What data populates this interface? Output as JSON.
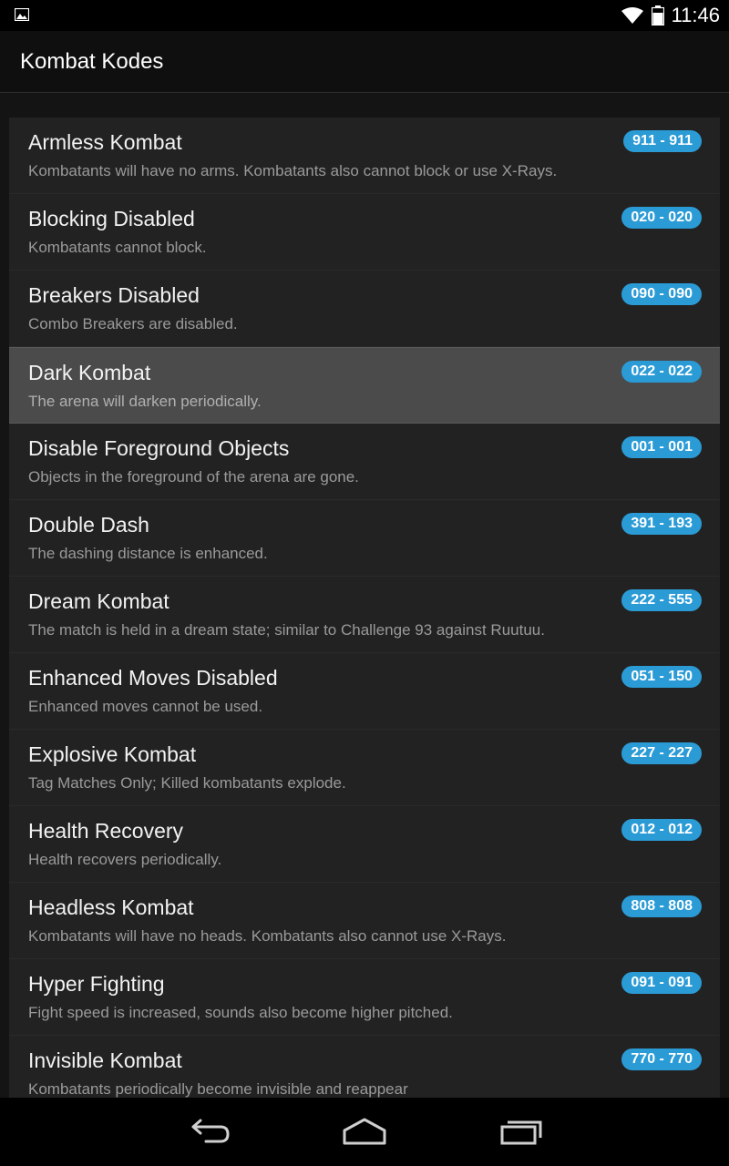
{
  "status_bar": {
    "time": "11:46",
    "icons": [
      "gallery-icon",
      "wifi-icon",
      "battery-icon"
    ]
  },
  "action_bar": {
    "title": "Kombat Kodes"
  },
  "kodes": [
    {
      "name": "Armless Kombat",
      "description": "Kombatants will have no arms. Kombatants also cannot block or use X-Rays.",
      "code": "911 - 911"
    },
    {
      "name": "Blocking Disabled",
      "description": "Kombatants cannot block.",
      "code": "020 - 020"
    },
    {
      "name": "Breakers Disabled",
      "description": "Combo Breakers are disabled.",
      "code": "090 - 090"
    },
    {
      "name": "Dark Kombat",
      "description": "The arena will darken periodically.",
      "code": "022 - 022",
      "selected": true
    },
    {
      "name": "Disable Foreground Objects",
      "description": "Objects in the foreground of the arena are gone.",
      "code": "001 - 001"
    },
    {
      "name": "Double Dash",
      "description": "The dashing distance is enhanced.",
      "code": "391 - 193"
    },
    {
      "name": "Dream Kombat",
      "description": "The match is held in a dream state; similar to Challenge 93 against Ruutuu.",
      "code": "222 - 555"
    },
    {
      "name": "Enhanced Moves Disabled",
      "description": "Enhanced moves cannot be used.",
      "code": "051 - 150"
    },
    {
      "name": "Explosive Kombat",
      "description": "Tag Matches Only; Killed kombatants explode.",
      "code": "227 - 227"
    },
    {
      "name": "Health Recovery",
      "description": "Health recovers periodically.",
      "code": "012 - 012"
    },
    {
      "name": "Headless Kombat",
      "description": "Kombatants will have no heads. Kombatants also cannot use X-Rays.",
      "code": "808 - 808"
    },
    {
      "name": "Hyper Fighting",
      "description": "Fight speed is increased, sounds also become higher pitched.",
      "code": "091 - 091"
    },
    {
      "name": "Invisible Kombat",
      "description": "Kombatants periodically become invisible and reappear",
      "code": "770 - 770"
    }
  ],
  "colors": {
    "code_badge": "#2b9bd6",
    "row_background": "#222222",
    "selected_row_background": "#4b4b4b",
    "page_background": "#141414"
  },
  "navigation_bar": {
    "buttons": [
      "back-icon",
      "home-icon",
      "recent-apps-icon"
    ]
  }
}
